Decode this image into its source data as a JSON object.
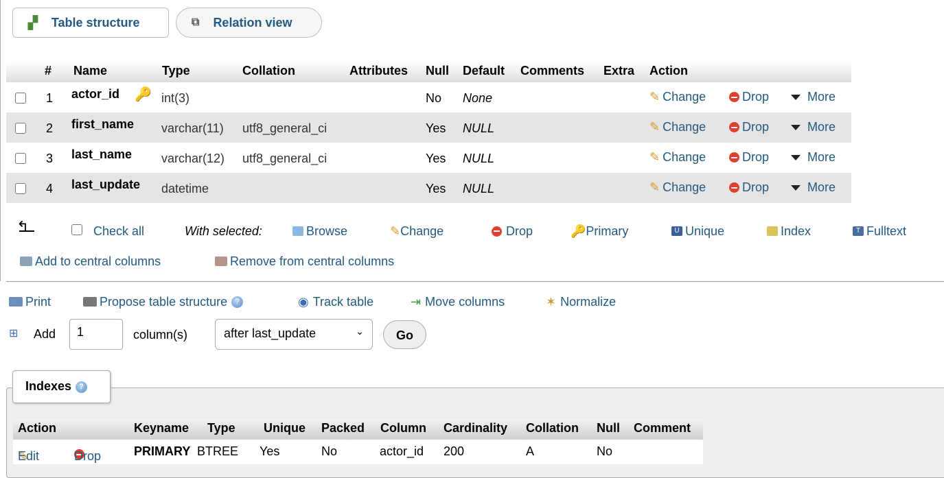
{
  "tabs": {
    "structure": "Table structure",
    "relation": "Relation view"
  },
  "structure_table": {
    "headers": {
      "num": "#",
      "name": "Name",
      "type": "Type",
      "collation": "Collation",
      "attributes": "Attributes",
      "null": "Null",
      "default": "Default",
      "comments": "Comments",
      "extra": "Extra",
      "action": "Action"
    },
    "rows": [
      {
        "num": "1",
        "name": "actor_id",
        "type": "int(3)",
        "collation": "",
        "null": "No",
        "default": "None",
        "primary_key": true
      },
      {
        "num": "2",
        "name": "first_name",
        "type": "varchar(11)",
        "collation": "utf8_general_ci",
        "null": "Yes",
        "default": "NULL"
      },
      {
        "num": "3",
        "name": "last_name",
        "type": "varchar(12)",
        "collation": "utf8_general_ci",
        "null": "Yes",
        "default": "NULL"
      },
      {
        "num": "4",
        "name": "last_update",
        "type": "datetime",
        "collation": "",
        "null": "Yes",
        "default": "NULL"
      }
    ],
    "row_actions": {
      "change": "Change",
      "drop": "Drop",
      "more": "More"
    }
  },
  "with_selected": {
    "check_all": "Check all",
    "label": "With selected:",
    "browse": "Browse",
    "change": "Change",
    "drop": "Drop",
    "primary": "Primary",
    "unique": "Unique",
    "index": "Index",
    "fulltext": "Fulltext",
    "add_central": "Add to central columns",
    "remove_central": "Remove from central columns"
  },
  "toolbar": {
    "print": "Print",
    "propose": "Propose table structure",
    "track": "Track table",
    "move": "Move columns",
    "normalize": "Normalize"
  },
  "add_columns": {
    "add_label": "Add",
    "count": "1",
    "unit_label": "column(s)",
    "position": "after last_update",
    "go": "Go"
  },
  "indexes": {
    "legend": "Indexes",
    "headers": {
      "action": "Action",
      "keyname": "Keyname",
      "type": "Type",
      "unique": "Unique",
      "packed": "Packed",
      "column": "Column",
      "cardinality": "Cardinality",
      "collation": "Collation",
      "null": "Null",
      "comment": "Comment"
    },
    "row": {
      "edit": "Edit",
      "drop": "Drop",
      "keyname": "PRIMARY",
      "type": "BTREE",
      "unique": "Yes",
      "packed": "No",
      "column": "actor_id",
      "cardinality": "200",
      "collation": "A",
      "null": "No",
      "comment": ""
    }
  },
  "colors": {
    "link": "#235a81",
    "drop": "#e0402f",
    "alt_row": "#e5e5e5"
  },
  "icons": [
    "structure-icon",
    "relation-icon",
    "key-icon",
    "pencil-icon",
    "drop-icon",
    "more-triangle-icon",
    "return-arrow-icon",
    "browse-icon",
    "unique-icon",
    "index-icon",
    "fulltext-icon",
    "central-columns-icon",
    "print-icon",
    "propose-icon",
    "help-icon",
    "eye-icon",
    "move-icon",
    "normalize-icon",
    "add-column-icon"
  ]
}
